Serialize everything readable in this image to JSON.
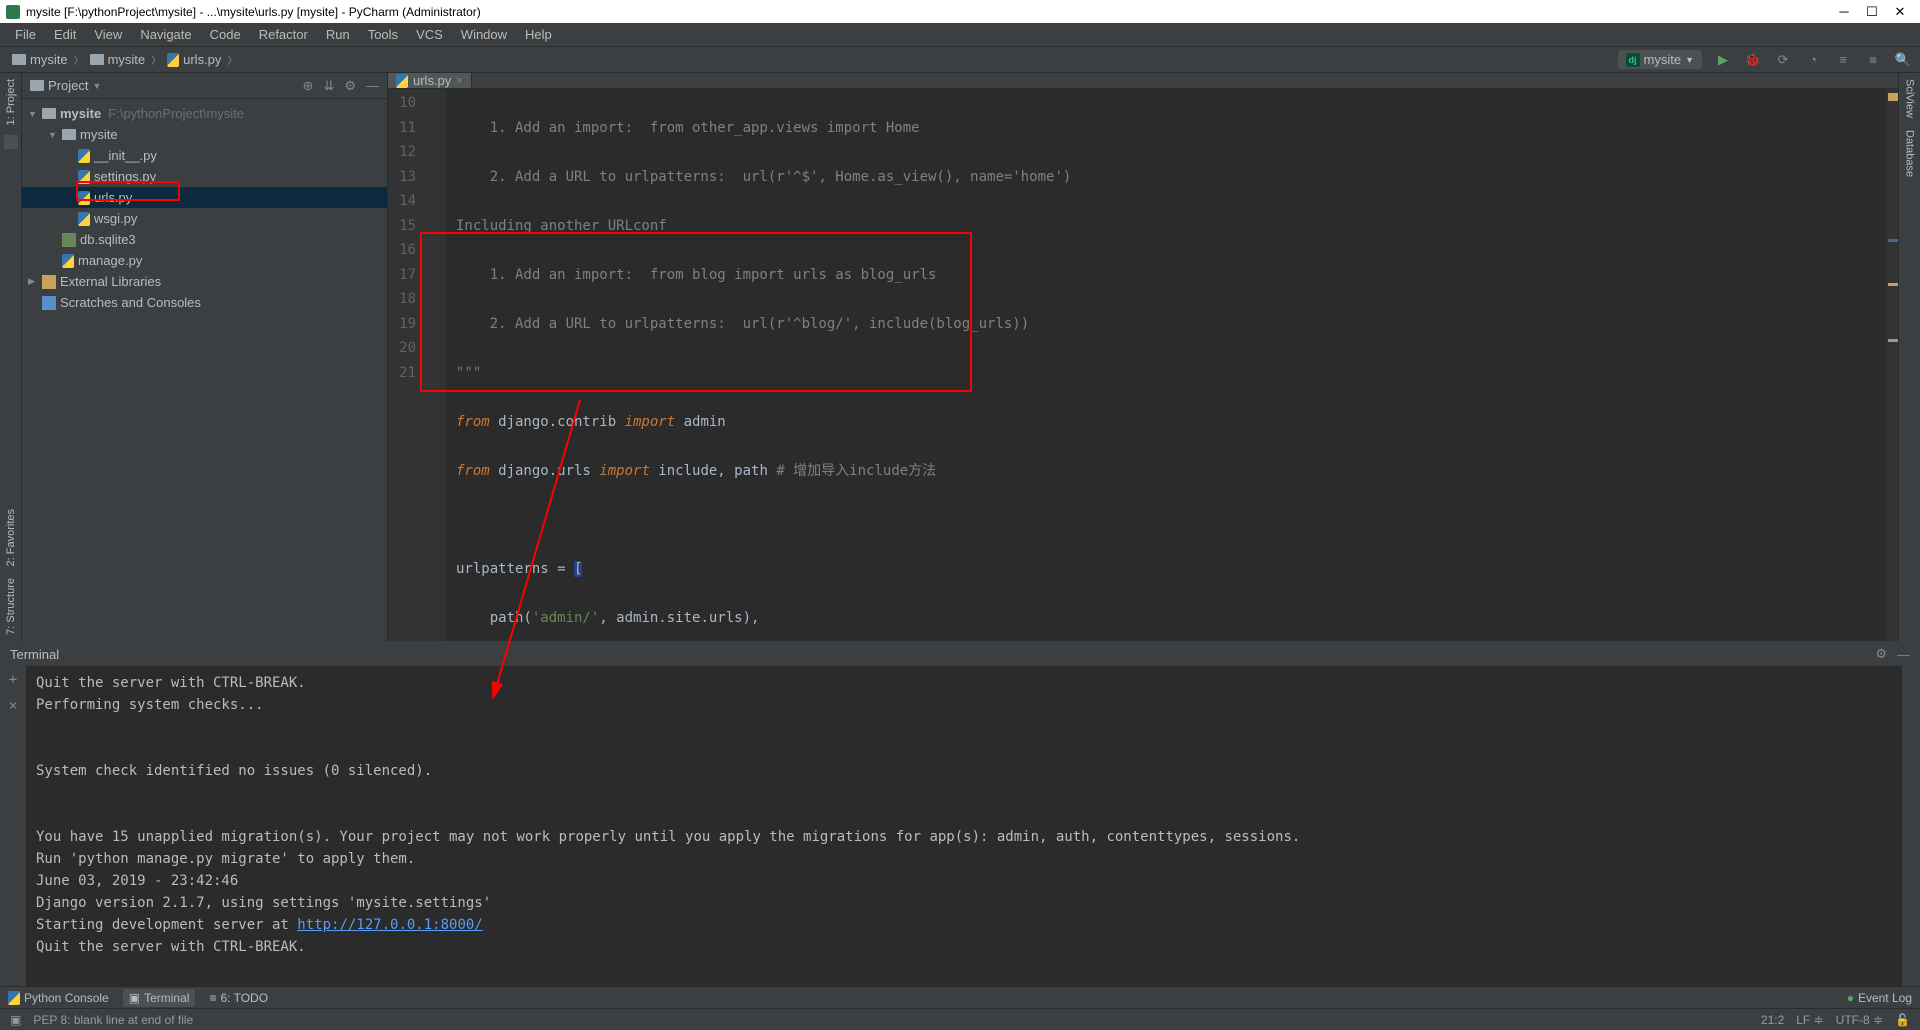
{
  "window": {
    "title": "mysite [F:\\pythonProject\\mysite] - ...\\mysite\\urls.py [mysite] - PyCharm (Administrator)"
  },
  "menu": [
    "File",
    "Edit",
    "View",
    "Navigate",
    "Code",
    "Refactor",
    "Run",
    "Tools",
    "VCS",
    "Window",
    "Help"
  ],
  "breadcrumb": [
    "mysite",
    "mysite",
    "urls.py"
  ],
  "run_config": "mysite",
  "project_panel": {
    "title": "Project",
    "tree": {
      "root": "mysite",
      "root_path": "F:\\pythonProject\\mysite",
      "folder": "mysite",
      "files": [
        "__init__.py",
        "settings.py",
        "urls.py",
        "wsgi.py"
      ],
      "root_files": [
        "db.sqlite3",
        "manage.py"
      ],
      "libs": "External Libraries",
      "scratches": "Scratches and Consoles"
    }
  },
  "editor": {
    "tab": "urls.py",
    "lines": [
      "10",
      "11",
      "12",
      "13",
      "14",
      "15",
      "16",
      "17",
      "18",
      "19",
      "20",
      "21"
    ],
    "code": {
      "l10": "    1. Add an import:  from other_app.views import Home",
      "l11": "    2. Add a URL to urlpatterns:  url(r'^$', Home.as_view(), name='home')",
      "l12": "Including another URLconf",
      "l13": "    1. Add an import:  from blog import urls as blog_urls",
      "l14": "    2. Add a URL to urlpatterns:  url(r'^blog/', include(blog_urls))",
      "l15": "\"\"\"",
      "l16_from": "from",
      "l16_mod": " django.contrib ",
      "l16_imp": "import",
      "l16_rest": " admin",
      "l17_from": "from",
      "l17_mod": " django.urls ",
      "l17_imp": "import",
      "l17_rest": " include, path ",
      "l17_cmt": "# 增加导入include方法",
      "l19_a": "urlpatterns = ",
      "l19_b": "[",
      "l20_a": "    path(",
      "l20_b": "'admin/'",
      "l20_c": ", admin.site.urls),",
      "l21": "]"
    }
  },
  "terminal": {
    "title": "Terminal",
    "lines": {
      "l1": "Quit the server with CTRL-BREAK.",
      "l2": "Performing system checks...",
      "l3": "System check identified no issues (0 silenced).",
      "l4": "You have 15 unapplied migration(s). Your project may not work properly until you apply the migrations for app(s): admin, auth, contenttypes, sessions.",
      "l5": "Run 'python manage.py migrate' to apply them.",
      "l6": "June 03, 2019 - 23:42:46",
      "l7": "Django version 2.1.7, using settings 'mysite.settings'",
      "l8a": "Starting development server at ",
      "l8b": "http://127.0.0.1:8000/",
      "l9": "Quit the server with CTRL-BREAK."
    }
  },
  "bottom_tools": {
    "python_console": "Python Console",
    "terminal": "Terminal",
    "todo": "6: TODO",
    "event_log": "Event Log"
  },
  "status": {
    "msg": "PEP 8: blank line at end of file",
    "pos": "21:2",
    "le": "LF",
    "enc": "UTF-8"
  },
  "side_tabs": {
    "project": "1: Project",
    "structure": "7: Structure",
    "favorites": "2: Favorites",
    "sciview": "SciView",
    "database": "Database"
  }
}
